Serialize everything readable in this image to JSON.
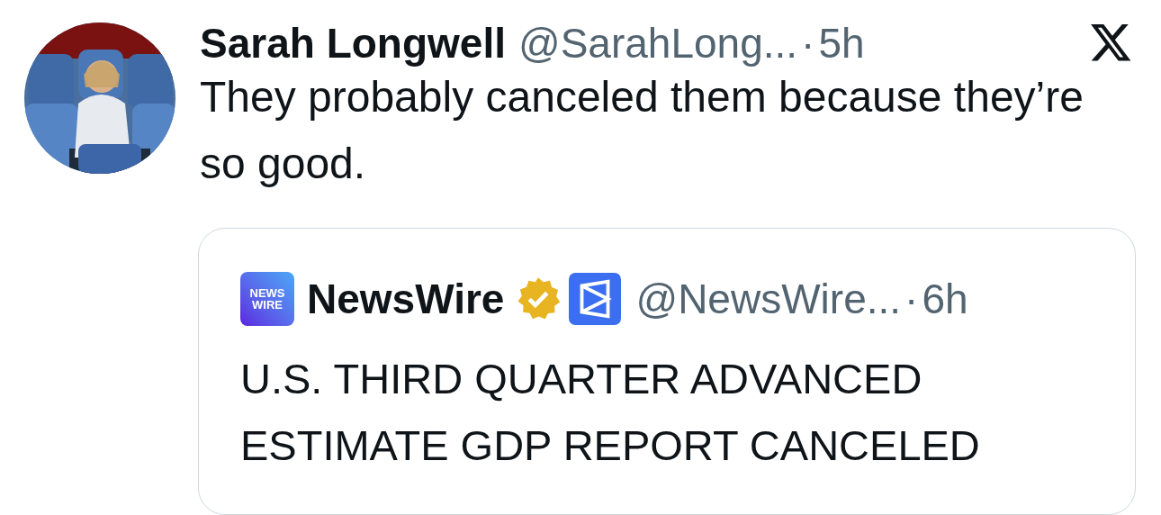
{
  "post": {
    "author": {
      "name": "Sarah Longwell",
      "handle": "@SarahLong...",
      "separator": "·",
      "time": "5h"
    },
    "text": "They probably canceled them because they’re so good.",
    "quoted": {
      "logo_text": [
        "NEWS",
        "WIRE"
      ],
      "author": {
        "name": "NewsWire",
        "verified": true,
        "affiliate_badge": true,
        "handle": "@NewsWire...",
        "separator": "·",
        "time": "6h"
      },
      "text_lines": [
        "U.S. THIRD QUARTER ADVANCED",
        "ESTIMATE GDP REPORT CANCELED"
      ]
    }
  }
}
